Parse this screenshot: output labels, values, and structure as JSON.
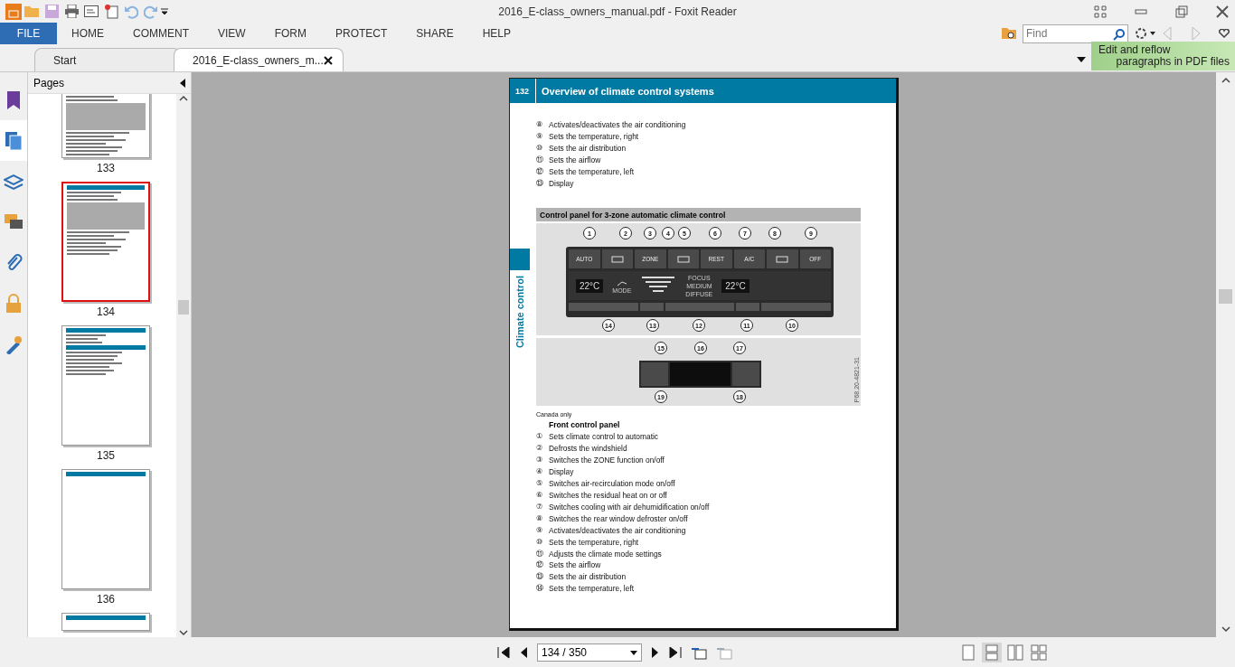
{
  "window": {
    "title": "2016_E-class_owners_manual.pdf - Foxit Reader"
  },
  "menu": [
    {
      "label": "FILE",
      "selected": true
    },
    {
      "label": "HOME",
      "selected": false
    },
    {
      "label": "COMMENT",
      "selected": false
    },
    {
      "label": "VIEW",
      "selected": false
    },
    {
      "label": "FORM",
      "selected": false
    },
    {
      "label": "PROTECT",
      "selected": false
    },
    {
      "label": "SHARE",
      "selected": false
    },
    {
      "label": "HELP",
      "selected": false
    }
  ],
  "search": {
    "placeholder": "Find"
  },
  "doc_tabs": [
    {
      "label": "Start",
      "selected": false
    },
    {
      "label": "2016_E-class_owners_m...",
      "selected": true
    }
  ],
  "promo": {
    "line1": "Edit and reflow",
    "line2": "paragraphs in PDF files"
  },
  "sidebar": {
    "title": "Pages",
    "tools": [
      {
        "kind": "bookmark",
        "selected": false
      },
      {
        "kind": "pages",
        "selected": true
      },
      {
        "kind": "layers",
        "selected": false
      },
      {
        "kind": "comments",
        "selected": false
      },
      {
        "kind": "attachment",
        "selected": false
      },
      {
        "kind": "security",
        "selected": false
      },
      {
        "kind": "signature",
        "selected": false
      }
    ]
  },
  "thumbnails": [
    {
      "label": "133",
      "selected": false,
      "kind": "panel",
      "cut": true
    },
    {
      "label": "134",
      "selected": true,
      "kind": "panel",
      "cut": false
    },
    {
      "label": "135",
      "selected": false,
      "kind": "text",
      "cut": false
    },
    {
      "label": "136",
      "selected": false,
      "kind": "blank",
      "cut": false
    }
  ],
  "page": {
    "number": "132",
    "title": "Overview of climate control systems",
    "side_tab": "Climate control",
    "list_top": [
      {
        "marker": "⑧",
        "text": "Activates/deactivates the air conditioning"
      },
      {
        "marker": "⑨",
        "text": "Sets the temperature, right"
      },
      {
        "marker": "⑩",
        "text": "Sets the air distribution"
      },
      {
        "marker": "⑪",
        "text": "Sets the airflow"
      },
      {
        "marker": "⑫",
        "text": "Sets the temperature, left"
      },
      {
        "marker": "⑬",
        "text": "Display"
      }
    ],
    "section_heading": "Control panel for 3-zone automatic climate control",
    "figure": {
      "top_callouts": [
        "1",
        "2",
        "3",
        "4",
        "5",
        "6",
        "7",
        "8",
        "9"
      ],
      "buttons": [
        {
          "kind": "text",
          "label": "AUTO"
        },
        {
          "kind": "icon"
        },
        {
          "kind": "text",
          "label": "ZONE"
        },
        {
          "kind": "icon"
        },
        {
          "kind": "text",
          "label": "REST"
        },
        {
          "kind": "text",
          "label": "A/C"
        },
        {
          "kind": "icon"
        },
        {
          "kind": "text",
          "label": "OFF"
        }
      ],
      "left_temp": "22°C",
      "right_temp": "22°C",
      "mode_label": "MODE",
      "airflow_modes": [
        "FOCUS",
        "MEDIUM",
        "DIFFUSE"
      ],
      "bottom_callouts": [
        "14",
        "13",
        "12",
        "11",
        "10"
      ],
      "rear_callouts": [
        "15",
        "16",
        "17",
        "19",
        "18"
      ],
      "code": "P68.20-4821-31"
    },
    "caption": "Canada only",
    "subheading": "Front control panel",
    "list": [
      {
        "marker": "①",
        "text": "Sets climate control to automatic"
      },
      {
        "marker": "②",
        "text": "Defrosts the windshield"
      },
      {
        "marker": "③",
        "text": "Switches the ZONE function on/off"
      },
      {
        "marker": "④",
        "text": "Display"
      },
      {
        "marker": "⑤",
        "text": "Switches air-recirculation mode on/off"
      },
      {
        "marker": "⑥",
        "text": "Switches the residual heat on or off"
      },
      {
        "marker": "⑦",
        "text": "Switches cooling with air dehumidification on/off"
      },
      {
        "marker": "⑧",
        "text": "Switches the rear window defroster on/off"
      },
      {
        "marker": "⑨",
        "text": "Activates/deactivates the air conditioning"
      },
      {
        "marker": "⑩",
        "text": "Sets the temperature, right"
      },
      {
        "marker": "⑪",
        "text": "Adjusts the climate mode settings"
      },
      {
        "marker": "⑫",
        "text": "Sets the airflow"
      },
      {
        "marker": "⑬",
        "text": "Sets the air distribution"
      },
      {
        "marker": "⑭",
        "text": "Sets the temperature, left"
      }
    ]
  },
  "navigation": {
    "page_field": "134 / 350"
  },
  "view_modes": [
    {
      "kind": "single",
      "selected": false
    },
    {
      "kind": "continuous",
      "selected": true
    },
    {
      "kind": "facing",
      "selected": false
    },
    {
      "kind": "cover",
      "selected": false
    }
  ]
}
